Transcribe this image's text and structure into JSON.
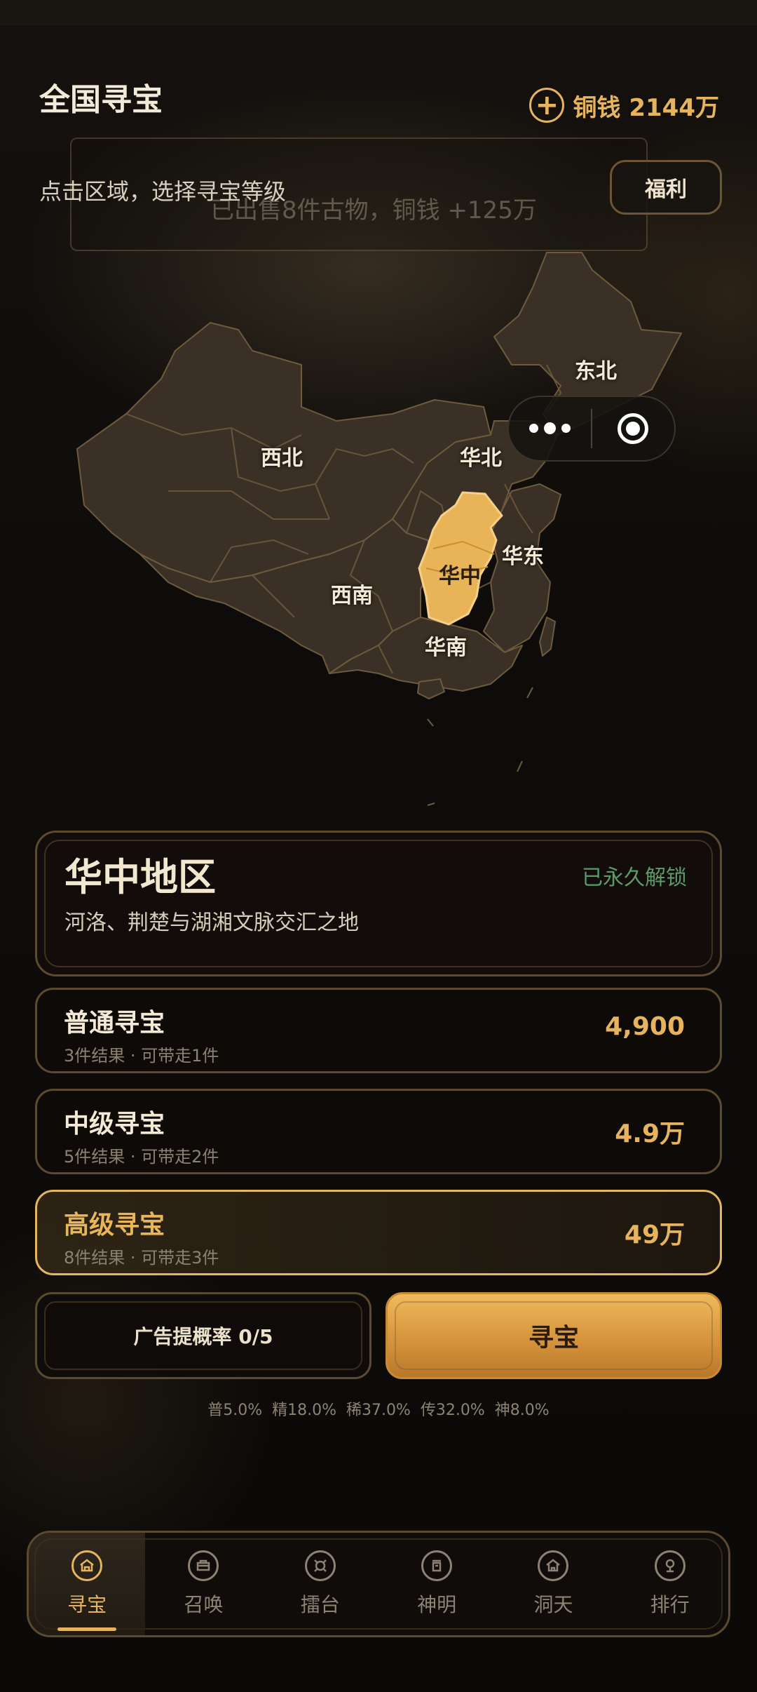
{
  "header": {
    "title": "全国寻宝",
    "currency_label": "铜钱",
    "currency_amount": "2144万"
  },
  "hint": "点击区域，选择寻宝等级",
  "toast": "已出售8件古物，铜钱 +125万",
  "welfare_label": "福利",
  "map": {
    "labels": {
      "dongbei": "东北",
      "xibei": "西北",
      "huabei": "华北",
      "huazhong": "华中",
      "huadong": "华东",
      "xinan": "西南",
      "huanan": "华南"
    },
    "selected_region": "华中",
    "colors": {
      "region": "#3a3025",
      "border": "#6e5a3c",
      "selected": "#e8b457"
    }
  },
  "region": {
    "name": "华中地区",
    "status": "已永久解锁",
    "description": "河洛、荆楚与湖湘文脉交汇之地"
  },
  "tiers": [
    {
      "name": "普通寻宝",
      "detail": "3件结果 · 可带走1件",
      "price": "4,900"
    },
    {
      "name": "中级寻宝",
      "detail": "5件结果 · 可带走2件",
      "price": "4.9万"
    },
    {
      "name": "高级寻宝",
      "detail": "8件结果 · 可带走3件",
      "price": "49万",
      "selected": true
    }
  ],
  "ad_button": "广告提概率 0/5",
  "hunt_button": "寻宝",
  "probabilities": "普5.0%  精18.0%  稀37.0%  传32.0%  神8.0%",
  "tabs": [
    {
      "label": "寻宝",
      "icon": "treasure-icon",
      "active": true
    },
    {
      "label": "召唤",
      "icon": "summon-icon"
    },
    {
      "label": "擂台",
      "icon": "arena-icon"
    },
    {
      "label": "神明",
      "icon": "deity-icon"
    },
    {
      "label": "洞天",
      "icon": "cave-icon"
    },
    {
      "label": "排行",
      "icon": "ranking-icon"
    }
  ],
  "accent_color": "#e6b45e"
}
